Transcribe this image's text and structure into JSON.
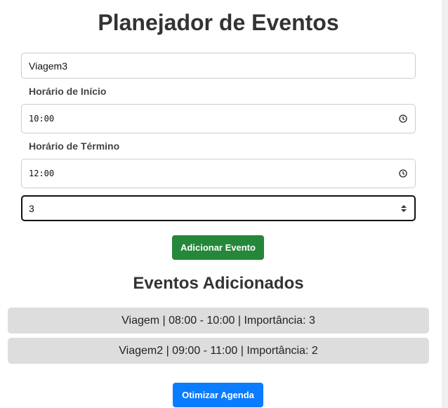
{
  "title": "Planejador de Eventos",
  "form": {
    "name_value": "Viagem3",
    "start_label": "Horário de Início",
    "start_value": "10:00",
    "end_label": "Horário de Término",
    "end_value": "12:00",
    "importance_value": "3",
    "add_button": "Adicionar Evento"
  },
  "events_title": "Eventos Adicionados",
  "events": [
    "Viagem | 08:00 - 10:00 | Importância: 3",
    "Viagem2 | 09:00 - 11:00 | Importância: 2"
  ],
  "optimize_button": "Otimizar Agenda",
  "colors": {
    "add_button": "#25873a",
    "optimize_button": "#0a7cff",
    "event_bg": "#dddddd"
  },
  "icons": {
    "time": "clock-icon",
    "number": "spinner-icon"
  }
}
